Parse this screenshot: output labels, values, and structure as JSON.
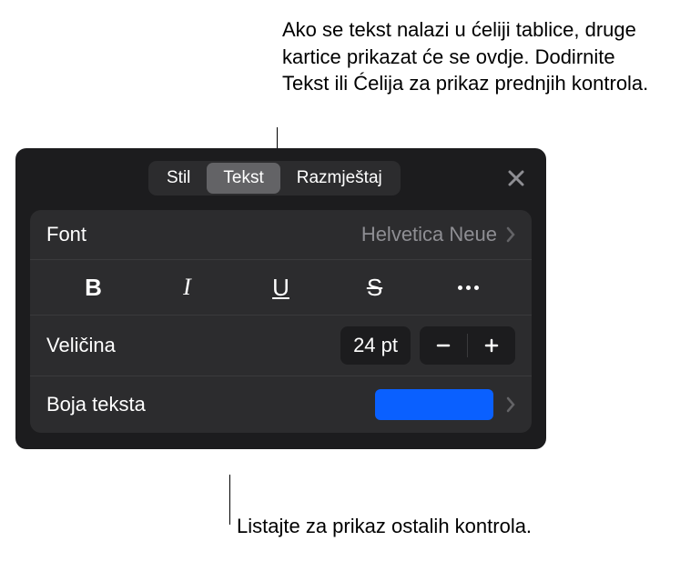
{
  "callouts": {
    "top": "Ako se tekst nalazi u ćeliji tablice, druge kartice prikazat će se ovdje. Dodirnite Tekst ili Ćelija za prikaz prednjih kontrola.",
    "bottom": "Listajte za prikaz ostalih kontrola."
  },
  "tabs": {
    "style": "Stil",
    "text": "Tekst",
    "layout": "Razmještaj"
  },
  "font": {
    "label": "Font",
    "value": "Helvetica Neue"
  },
  "styles": {
    "bold": "B",
    "italic": "I",
    "underline": "U",
    "strike": "S"
  },
  "size": {
    "label": "Veličina",
    "value": "24 pt"
  },
  "color": {
    "label": "Boja teksta",
    "value": "#0a60ff"
  }
}
